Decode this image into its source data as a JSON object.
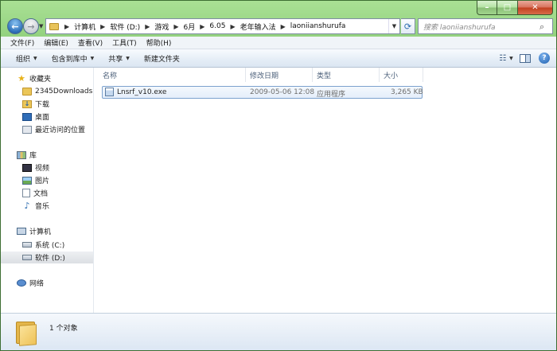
{
  "address": {
    "crumbs": [
      "计算机",
      "软件 (D:)",
      "游戏",
      "6月",
      "6.05",
      "老年输入法",
      "laoniianshurufa"
    ]
  },
  "search": {
    "placeholder": "搜索 laoniianshurufa"
  },
  "menubar": {
    "items": [
      "文件(F)",
      "编辑(E)",
      "查看(V)",
      "工具(T)",
      "帮助(H)"
    ]
  },
  "toolbar": {
    "organize": "组织",
    "include_in_library": "包含到库中",
    "share": "共享",
    "new_folder": "新建文件夹"
  },
  "navpane": {
    "favorites": {
      "label": "收藏夹",
      "items": [
        "2345Downloads",
        "下载",
        "桌面",
        "最近访问的位置"
      ]
    },
    "libraries": {
      "label": "库",
      "items": [
        "视频",
        "图片",
        "文档",
        "音乐"
      ]
    },
    "computer": {
      "label": "计算机",
      "items": [
        "系统 (C:)",
        "软件 (D:)"
      ]
    },
    "network": {
      "label": "网络"
    }
  },
  "columns": [
    "名称",
    "修改日期",
    "类型",
    "大小"
  ],
  "files": [
    {
      "name": "Lnsrf_v10.exe",
      "modified": "2009-05-06 12:08",
      "type": "应用程序",
      "size": "3,265 KB"
    }
  ],
  "status": {
    "count_text": "1 个对象"
  },
  "colors": {
    "selection_border": "#7da2ce",
    "window_tint": "#8cc578",
    "header_text": "#4c607a"
  }
}
